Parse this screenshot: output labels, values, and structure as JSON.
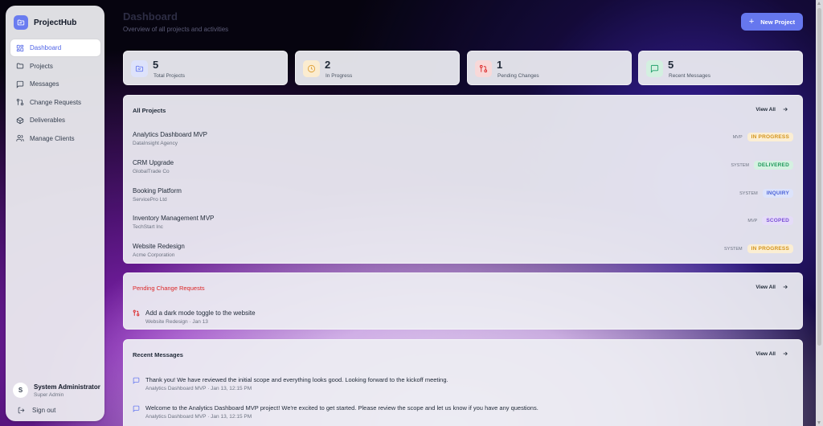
{
  "app": {
    "name": "ProjectHub"
  },
  "nav": [
    {
      "label": "Dashboard",
      "icon": "dashboard-icon",
      "active": true
    },
    {
      "label": "Projects",
      "icon": "folder-icon"
    },
    {
      "label": "Messages",
      "icon": "message-icon"
    },
    {
      "label": "Change Requests",
      "icon": "git-pull-request-icon"
    },
    {
      "label": "Deliverables",
      "icon": "package-icon"
    },
    {
      "label": "Manage Clients",
      "icon": "users-icon"
    }
  ],
  "user": {
    "initial": "S",
    "name": "System Administrator",
    "role": "Super Admin"
  },
  "signout_label": "Sign out",
  "header": {
    "title": "Dashboard",
    "subtitle": "Overview of all projects and activities",
    "new_button_label": "New Project"
  },
  "stats": [
    {
      "value": "5",
      "label": "Total Projects",
      "icon": "folder-icon",
      "color": "#6a7cf0"
    },
    {
      "value": "2",
      "label": "In Progress",
      "icon": "clock-icon",
      "color": "#e0a23a"
    },
    {
      "value": "1",
      "label": "Pending Changes",
      "icon": "git-pull-request-icon",
      "color": "#dc2626"
    },
    {
      "value": "5",
      "label": "Recent Messages",
      "icon": "message-icon",
      "color": "#22a06b"
    }
  ],
  "projects": {
    "title": "All Projects",
    "view_all": "View All",
    "rows": [
      {
        "name": "Analytics Dashboard MVP",
        "client": "DataInsight Agency",
        "type": "MVP",
        "status": "IN PROGRESS",
        "status_color": "#d4941c",
        "status_bg": "#fbeed3"
      },
      {
        "name": "CRM Upgrade",
        "client": "GlobalTrade Co",
        "type": "SYSTEM",
        "status": "DELIVERED",
        "status_color": "#1f9a5b",
        "status_bg": "#d5f1e1"
      },
      {
        "name": "Booking Platform",
        "client": "ServicePro Ltd",
        "type": "SYSTEM",
        "status": "INQUIRY",
        "status_color": "#4b63d8",
        "status_bg": "#dce3fb"
      },
      {
        "name": "Inventory Management MVP",
        "client": "TechStart Inc",
        "type": "MVP",
        "status": "SCOPED",
        "status_color": "#7b4fd6",
        "status_bg": "#e5dcf8"
      },
      {
        "name": "Website Redesign",
        "client": "Acme Corporation",
        "type": "SYSTEM",
        "status": "IN PROGRESS",
        "status_color": "#d4941c",
        "status_bg": "#fbeed3"
      }
    ]
  },
  "change_requests": {
    "title": "Pending Change Requests",
    "view_all": "View All",
    "items": [
      {
        "title": "Add a dark mode toggle to the website",
        "sub": "Website Redesign · Jan 13"
      }
    ]
  },
  "messages": {
    "title": "Recent Messages",
    "view_all": "View All",
    "items": [
      {
        "text": "Thank you! We have reviewed the initial scope and everything looks good. Looking forward to the kickoff meeting.",
        "sub": "Analytics Dashboard MVP · Jan 13, 12:15 PM"
      },
      {
        "text": "Welcome to the Analytics Dashboard MVP project! We're excited to get started. Please review the scope and let us know if you have any questions.",
        "sub": "Analytics Dashboard MVP · Jan 13, 12:15 PM"
      }
    ]
  }
}
